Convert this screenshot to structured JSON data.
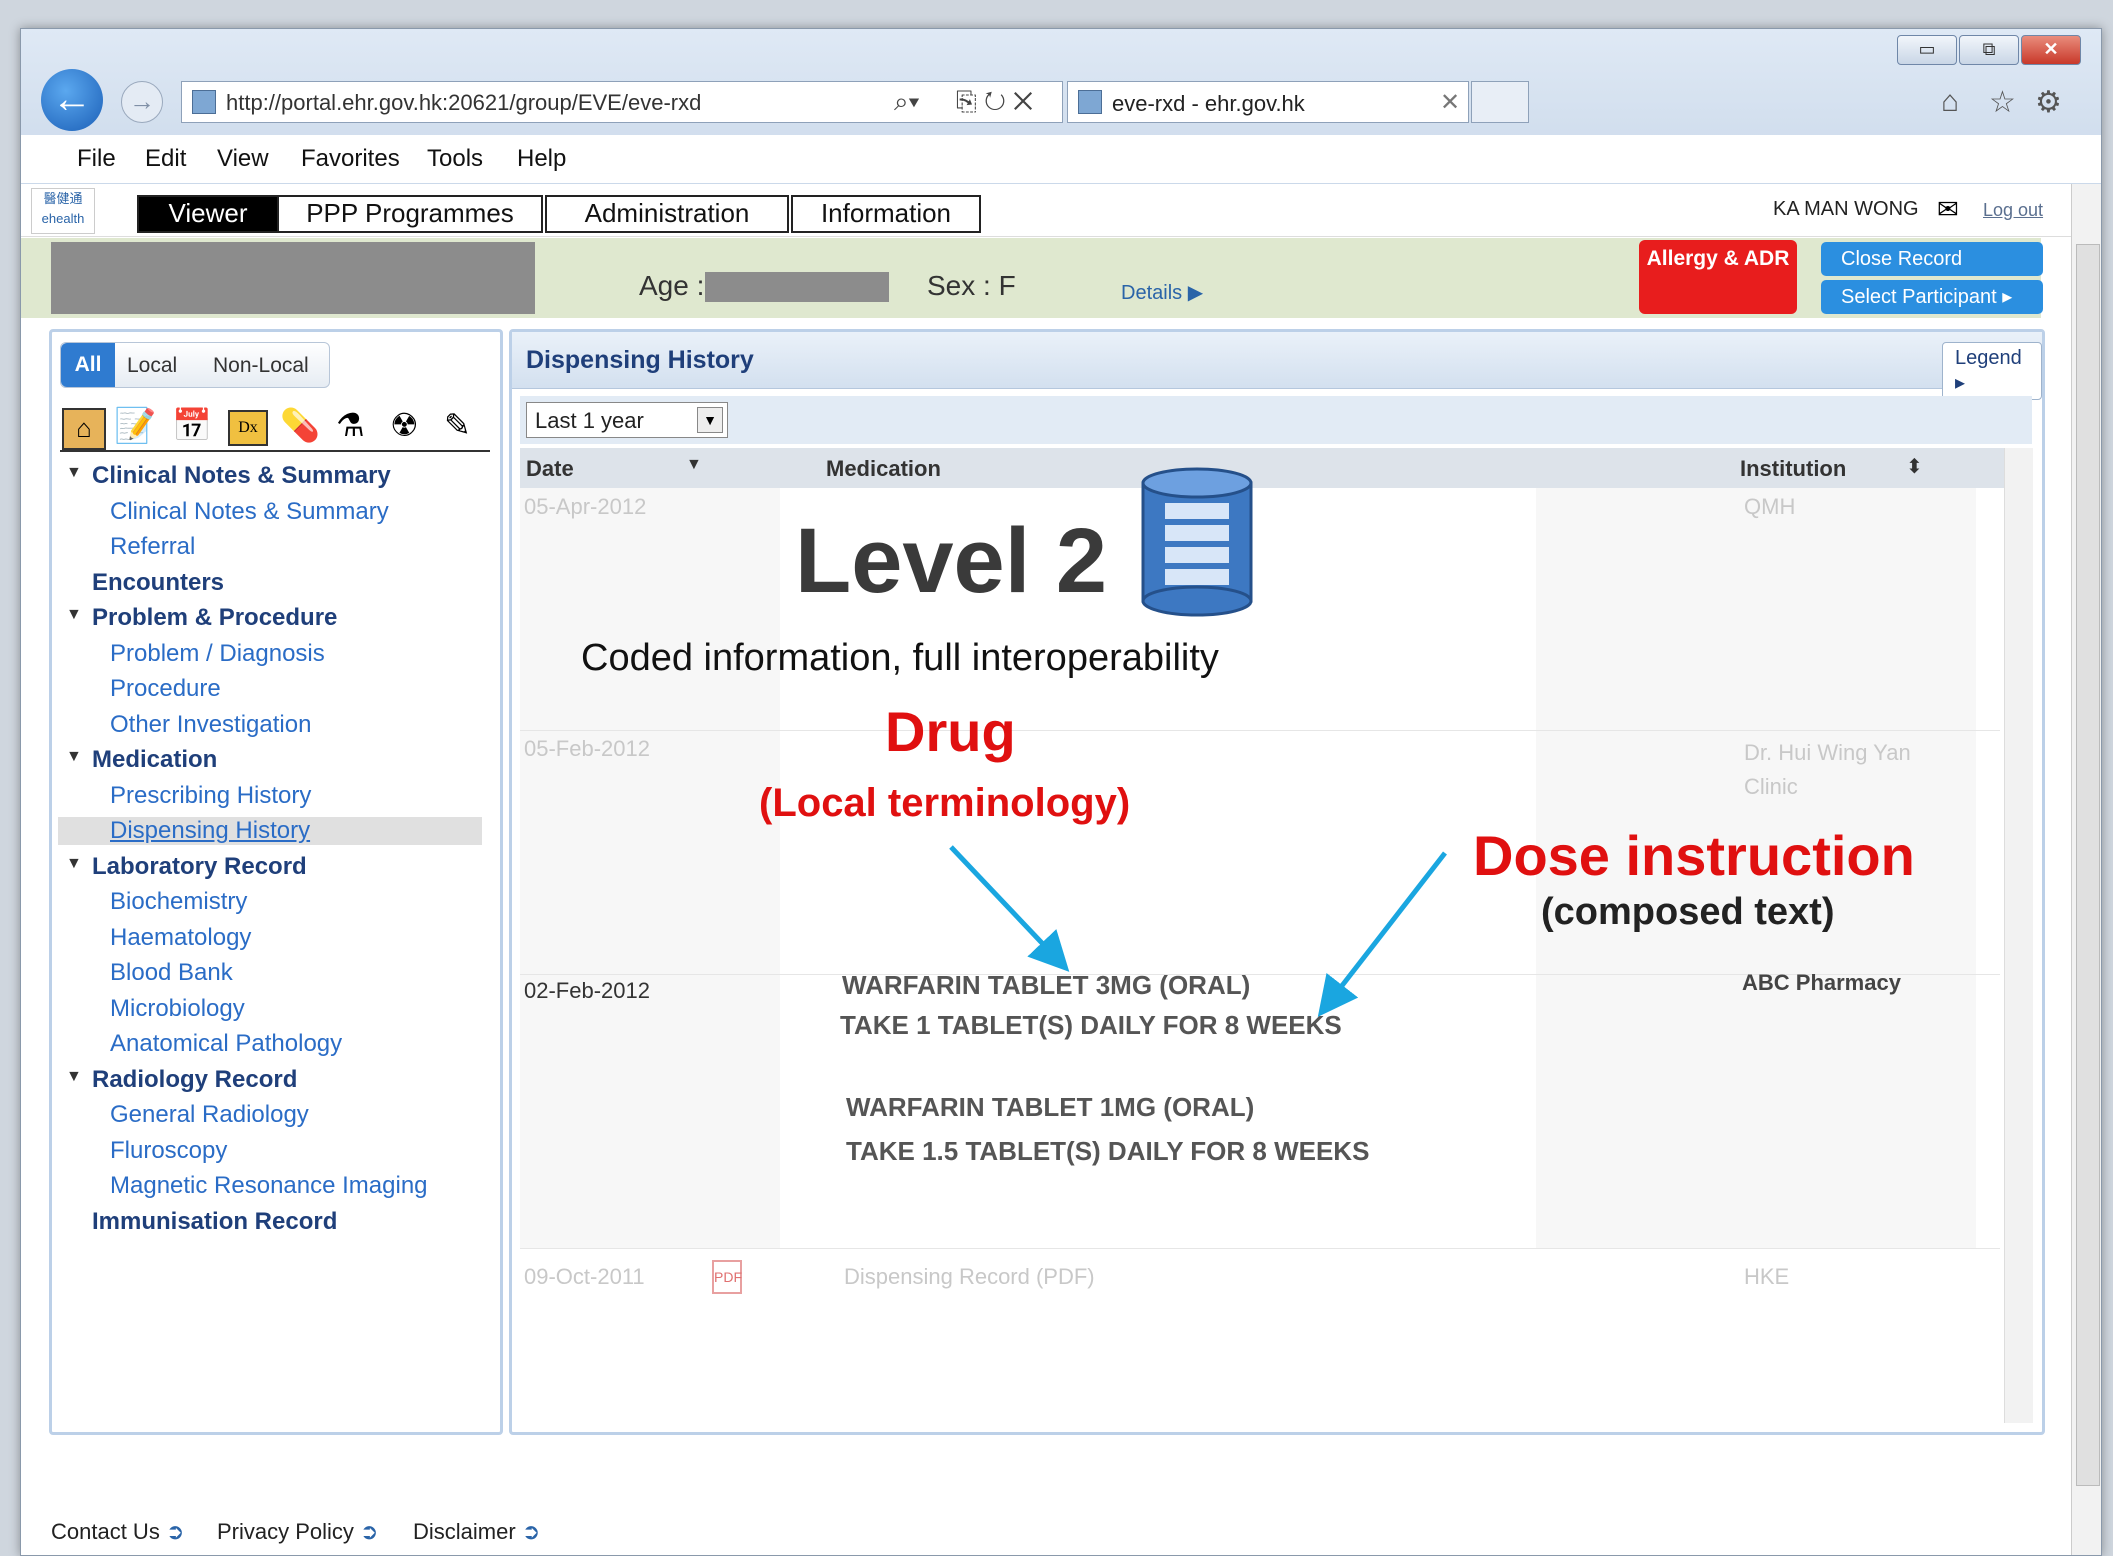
{
  "browser": {
    "url": "http://portal.ehr.gov.hk:20621/group/EVE/eve-rxd",
    "tab_title": "eve-rxd - ehr.gov.hk",
    "menu": [
      "File",
      "Edit",
      "View",
      "Favorites",
      "Tools",
      "Help"
    ]
  },
  "app": {
    "logo_text": "醫健通 ehealth",
    "tabs": [
      "Viewer",
      "PPP Programmes",
      "Administration",
      "Information"
    ],
    "user": "KA MAN WONG",
    "logout": "Log out"
  },
  "patient": {
    "age_label": "Age :",
    "sex_label": "Sex : F",
    "details_label": "Details ▶",
    "allergy_label": "Allergy & ADR",
    "close_record": "Close Record",
    "select_participant": "Select Participant ▸"
  },
  "sidebar": {
    "filters": [
      "All",
      "Local",
      "Non-Local"
    ],
    "tree": [
      {
        "label": "Clinical Notes & Summary",
        "type": "h",
        "arrow": true
      },
      {
        "label": "Clinical Notes & Summary",
        "type": "s"
      },
      {
        "label": "Referral",
        "type": "s"
      },
      {
        "label": "Encounters",
        "type": "h",
        "arrow": false
      },
      {
        "label": "Problem & Procedure",
        "type": "h",
        "arrow": true
      },
      {
        "label": "Problem / Diagnosis",
        "type": "s"
      },
      {
        "label": "Procedure",
        "type": "s"
      },
      {
        "label": "Other Investigation",
        "type": "s"
      },
      {
        "label": "Medication",
        "type": "h",
        "arrow": true
      },
      {
        "label": "Prescribing History",
        "type": "s"
      },
      {
        "label": "Dispensing History",
        "type": "s",
        "selected": true
      },
      {
        "label": "Laboratory Record",
        "type": "h",
        "arrow": true
      },
      {
        "label": "Biochemistry",
        "type": "s"
      },
      {
        "label": "Haematology",
        "type": "s"
      },
      {
        "label": "Blood Bank",
        "type": "s"
      },
      {
        "label": "Microbiology",
        "type": "s"
      },
      {
        "label": "Anatomical Pathology",
        "type": "s"
      },
      {
        "label": "Radiology Record",
        "type": "h",
        "arrow": true
      },
      {
        "label": "General Radiology",
        "type": "s"
      },
      {
        "label": "Fluroscopy",
        "type": "s"
      },
      {
        "label": "Magnetic Resonance Imaging",
        "type": "s"
      },
      {
        "label": "Immunisation Record",
        "type": "h",
        "arrow": false
      }
    ]
  },
  "main": {
    "panel_title": "Dispensing History",
    "legend": "Legend ▸",
    "period": "Last 1 year",
    "columns": {
      "date": "Date",
      "medication": "Medication",
      "institution": "Institution"
    },
    "rows": {
      "r1": {
        "date": "05-Apr-2012",
        "inst": "QMH"
      },
      "r2": {
        "date": "05-Feb-2012",
        "inst": "Dr. Hui Wing Yan Clinic"
      },
      "r3": {
        "date": "02-Feb-2012",
        "inst": "ABC Pharmacy",
        "med1": "WARFARIN TABLET 3MG (ORAL)",
        "dose1": "TAKE 1 TABLET(S) DAILY FOR 8 WEEKS",
        "med2": "WARFARIN TABLET 1MG (ORAL)",
        "dose2": "TAKE 1.5 TABLET(S) DAILY FOR 8 WEEKS"
      },
      "r4": {
        "date": "09-Oct-2011",
        "med": "Dispensing Record (PDF)",
        "inst": "HKE"
      }
    }
  },
  "overlay": {
    "level": "Level 2",
    "subtitle": "Coded information, full interoperability",
    "drug": "Drug",
    "drug_sub": "(Local terminology)",
    "dose": "Dose instruction",
    "dose_sub": "(composed text)"
  },
  "footer": [
    "Contact Us",
    "Privacy Policy",
    "Disclaimer"
  ]
}
